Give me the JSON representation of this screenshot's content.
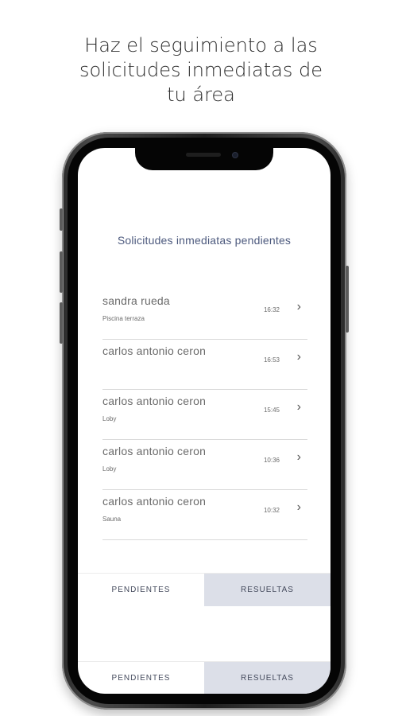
{
  "headline": {
    "line1": "Haz el seguimiento a las",
    "line2": "solicitudes inmediatas de",
    "line3": "tu área"
  },
  "screen": {
    "title": "Solicitudes inmediatas pendientes",
    "requests": [
      {
        "name": "sandra rueda",
        "place": "Piscina terraza",
        "time": "16:32"
      },
      {
        "name": "carlos antonio ceron",
        "place": "",
        "time": "16:53"
      },
      {
        "name": "carlos antonio ceron",
        "place": "Loby",
        "time": "15:45"
      },
      {
        "name": "carlos antonio ceron",
        "place": "Loby",
        "time": "10:36"
      },
      {
        "name": "carlos antonio ceron",
        "place": "Sauna",
        "time": "10:32"
      }
    ],
    "tabs": {
      "pending": "PENDIENTES",
      "resolved": "RESUELTAS"
    },
    "tabs_bottom": {
      "pending": "PENDIENTES",
      "resolved": "RESUELTAS"
    }
  },
  "colors": {
    "accent": "#4d5a7e",
    "active_tab": "#dcdfe8"
  },
  "icons": {
    "row_action": "chevron-right-icon"
  }
}
